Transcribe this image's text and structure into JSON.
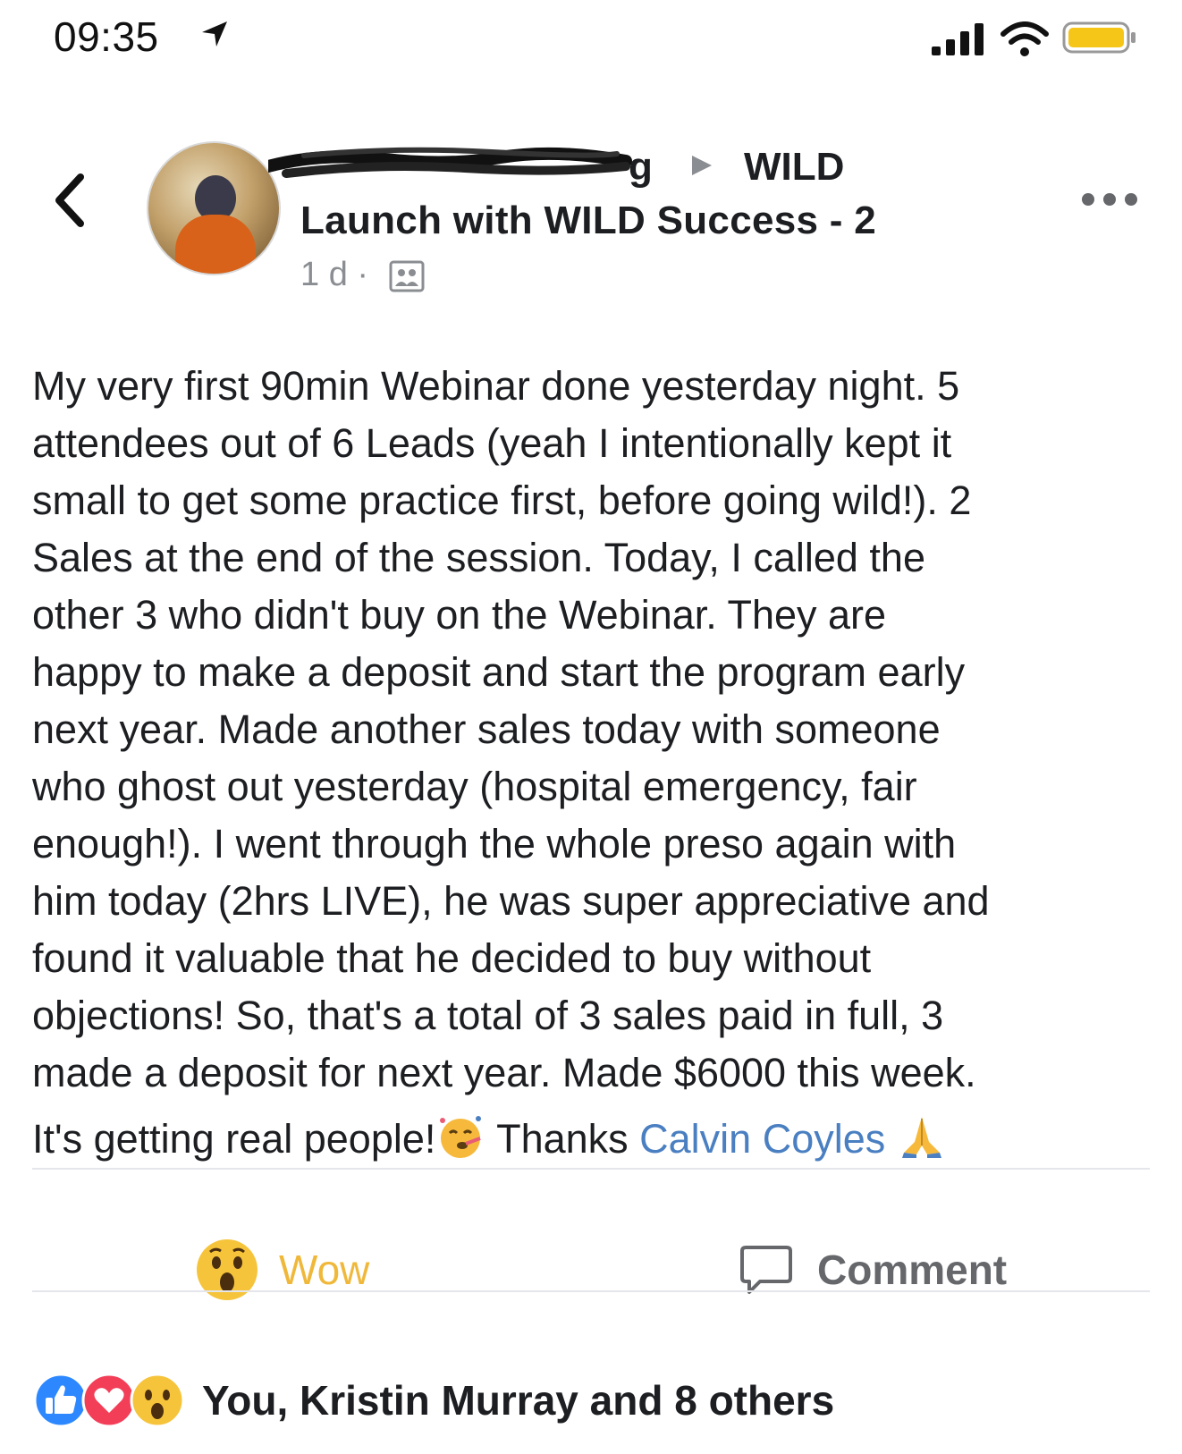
{
  "status_bar": {
    "time": "09:35",
    "icons": [
      "location-arrow-icon",
      "cellular-signal-icon",
      "wifi-icon",
      "battery-icon"
    ],
    "battery_color": "#f5c518"
  },
  "post_header": {
    "author_visible_tail": "g",
    "group_name_line1": "WILD",
    "group_name_line2": "Launch with WILD Success - 2",
    "timestamp": "1 d ·",
    "privacy_icon": "group-members-icon"
  },
  "post_body": {
    "lines": [
      "My very first 90min Webinar done yesterday night. 5",
      "attendees out of 6 Leads (yeah I intentionally kept it",
      "small to get some practice first, before going wild!). 2",
      "Sales at the end of the session. Today, I called the",
      "other 3 who didn't buy on the Webinar. They are",
      "happy to make a deposit and start the program early",
      "next year. Made another sales today with someone",
      "who ghost out yesterday (hospital emergency, fair",
      "enough!). I went through the whole preso again with",
      "him today (2hrs LIVE), he was super appreciative and",
      "found it valuable that he decided to buy without",
      "objections! So, that's a total of 3 sales paid in full, 3",
      "made a deposit for next year. Made $6000 this week."
    ],
    "last_line_prefix": "It's getting real people!",
    "last_line_thanks": " Thanks ",
    "mention": "Calvin Coyles",
    "mention_color": "#4a7fc1"
  },
  "actions": {
    "wow_label": "Wow",
    "wow_color": "#f0b83a",
    "comment_label": "Comment"
  },
  "reactions": {
    "icons": [
      "like-icon",
      "love-icon",
      "wow-icon"
    ],
    "summary": "You, Kristin Murray and 8 others"
  }
}
